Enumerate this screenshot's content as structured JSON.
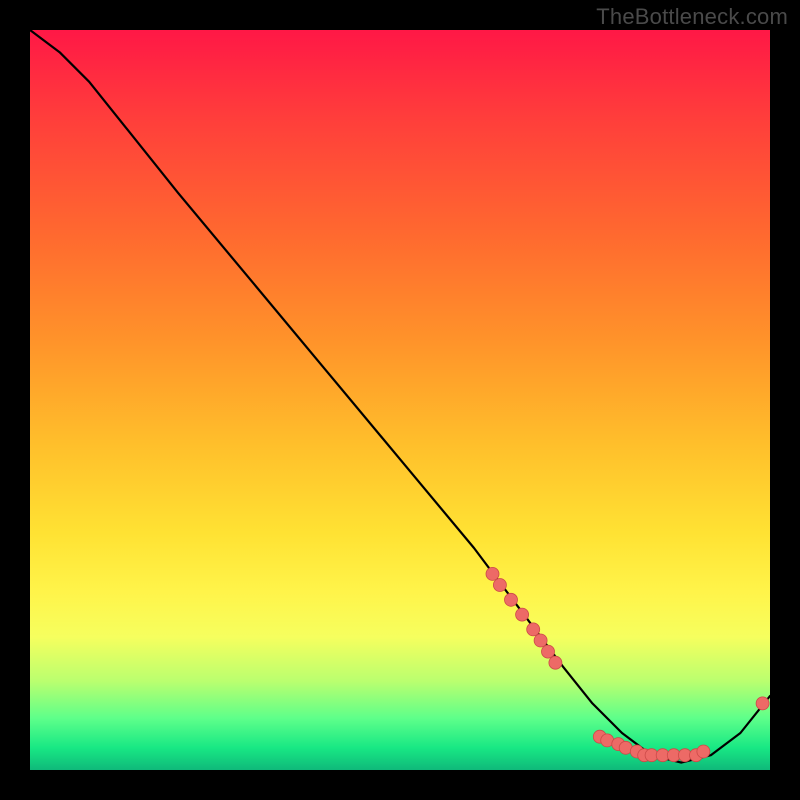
{
  "watermark": "TheBottleneck.com",
  "colors": {
    "curve": "#000000",
    "marker_fill": "#ed6a66",
    "marker_stroke": "#cc4a48",
    "background": "#000000"
  },
  "chart_data": {
    "type": "line",
    "title": "",
    "xlabel": "",
    "ylabel": "",
    "xlim": [
      0,
      100
    ],
    "ylim": [
      0,
      100
    ],
    "curve": {
      "x": [
        0,
        4,
        8,
        12,
        20,
        30,
        40,
        50,
        60,
        66,
        72,
        76,
        80,
        84,
        88,
        92,
        96,
        100
      ],
      "y": [
        100,
        97,
        93,
        88,
        78,
        66,
        54,
        42,
        30,
        22,
        14,
        9,
        5,
        2,
        1,
        2,
        5,
        10
      ]
    },
    "marker_clusters": [
      {
        "x": [
          62.5,
          63.5,
          65.0,
          66.5,
          68.0,
          69.0,
          70.0,
          71.0
        ],
        "y": [
          26.5,
          25.0,
          23.0,
          21.0,
          19.0,
          17.5,
          16.0,
          14.5
        ]
      },
      {
        "x": [
          77.0,
          78.0,
          79.5,
          80.5,
          82.0,
          83.0,
          84.0,
          85.5,
          87.0,
          88.5,
          90.0,
          91.0
        ],
        "y": [
          4.5,
          4.0,
          3.5,
          3.0,
          2.5,
          2.0,
          2.0,
          2.0,
          2.0,
          2.0,
          2.0,
          2.5
        ]
      },
      {
        "x": [
          99.0
        ],
        "y": [
          9.0
        ]
      }
    ]
  }
}
